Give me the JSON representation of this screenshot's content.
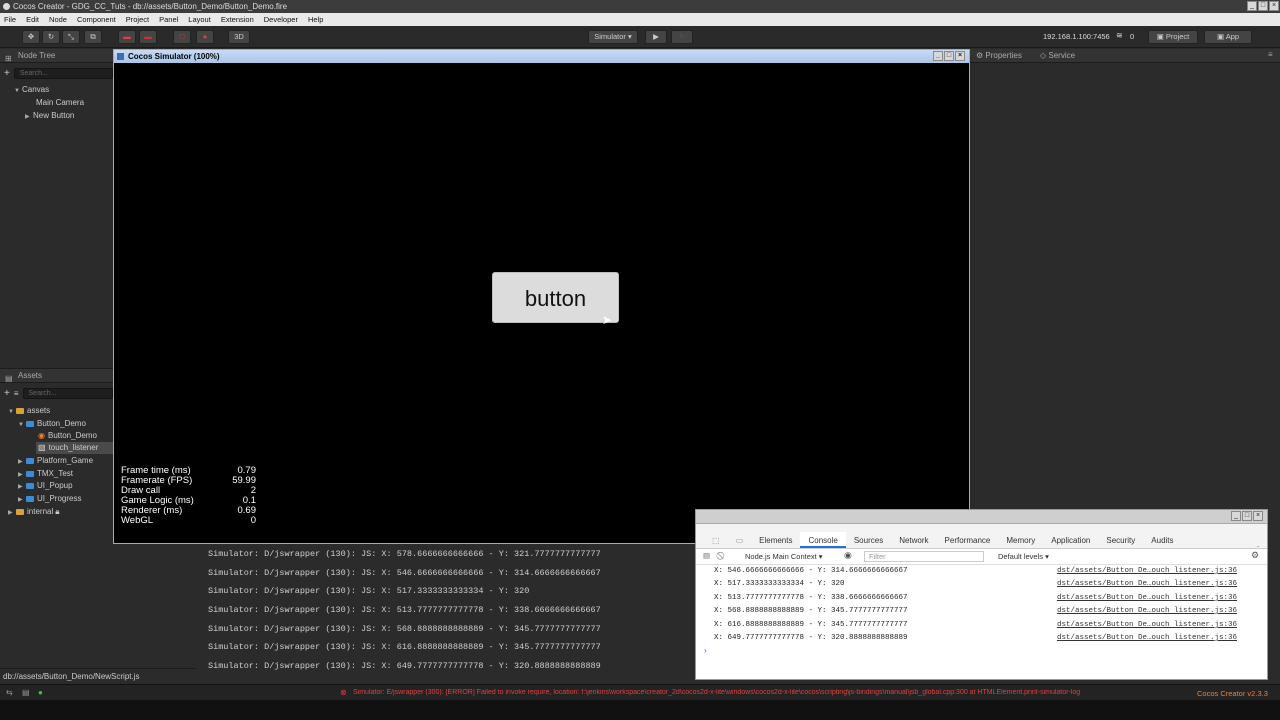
{
  "window": {
    "title": "Cocos Creator - GDG_CC_Tuts - db://assets/Button_Demo/Button_Demo.fire"
  },
  "menu": [
    "File",
    "Edit",
    "Node",
    "Component",
    "Project",
    "Panel",
    "Layout",
    "Extension",
    "Developer",
    "Help"
  ],
  "toolbar": {
    "mode_3d": "3D",
    "platform": "Simulator ▾",
    "ip": "192.168.1.100:7456",
    "connections": "0",
    "project_label": "Project",
    "app_label": "App"
  },
  "node_tree": {
    "title": "Node Tree",
    "search_placeholder": "Search...",
    "items": [
      "Canvas",
      "Main Camera",
      "New Button"
    ]
  },
  "assets": {
    "title": "Assets",
    "search_placeholder": "Search...",
    "items": [
      "assets",
      "Button_Demo",
      "Button_Demo",
      "touch_listener",
      "Platform_Game",
      "TMX_Test",
      "UI_Popup",
      "UI_Progress",
      "internal"
    ]
  },
  "right_tabs": {
    "properties": "Properties",
    "service": "Service"
  },
  "simulator": {
    "title": "Cocos Simulator (100%)",
    "button_label": "button",
    "stats": [
      {
        "label": "Frame time (ms)",
        "value": "0.79"
      },
      {
        "label": "Framerate (FPS)",
        "value": "59.99"
      },
      {
        "label": "Draw call",
        "value": "2"
      },
      {
        "label": "Game Logic (ms)",
        "value": "0.1"
      },
      {
        "label": "Renderer (ms)",
        "value": "0.69"
      },
      {
        "label": "WebGL",
        "value": "0"
      }
    ]
  },
  "log_lines": [
    "Simulator: D/jswrapper (130): JS: X: 578.6666666666666 - Y: 321.7777777777777",
    "Simulator: D/jswrapper (130): JS: X: 546.6666666666666 - Y: 314.6666666666667",
    "Simulator: D/jswrapper (130): JS: X: 517.3333333333334 - Y: 320",
    "Simulator: D/jswrapper (130): JS: X: 513.7777777777778 - Y: 338.6666666666667",
    "Simulator: D/jswrapper (130): JS: X: 568.8888888888889 - Y: 345.7777777777777",
    "Simulator: D/jswrapper (130): JS: X: 616.8888888888889 - Y: 345.7777777777777",
    "Simulator: D/jswrapper (130): JS: X: 649.7777777777778 - Y: 320.8888888888889"
  ],
  "devtools": {
    "tabs": [
      "Elements",
      "Console",
      "Sources",
      "Network",
      "Performance",
      "Memory",
      "Application",
      "Security",
      "Audits"
    ],
    "active_tab": "Console",
    "context": "Node.js Main Context ▾",
    "filter_placeholder": "Filter",
    "levels": "Default levels ▾",
    "lines": [
      {
        "text": "X: 546.6666666666666 - Y: 314.6666666666667",
        "src": "dst/assets/Button De…ouch listener.js:36"
      },
      {
        "text": "X: 517.3333333333334 - Y: 320",
        "src": "dst/assets/Button De…ouch listener.js:36"
      },
      {
        "text": "X: 513.7777777777778 - Y: 338.6666666666667",
        "src": "dst/assets/Button De…ouch listener.js:36"
      },
      {
        "text": "X: 568.8888888888889 - Y: 345.7777777777777",
        "src": "dst/assets/Button De…ouch listener.js:36"
      },
      {
        "text": "X: 616.8888888888889 - Y: 345.7777777777777",
        "src": "dst/assets/Button De…ouch listener.js:36"
      },
      {
        "text": "X: 649.7777777777778 - Y: 320.8888888888889",
        "src": "dst/assets/Button De…ouch listener.js:36"
      }
    ]
  },
  "status": {
    "path": "db://assets/Button_Demo/NewScript.js",
    "error": "Simulator: E/jswrapper (300): [ERROR] Failed to invoke require, location: f:\\jenkins\\workspace\\creator_2d\\cocos2d-x-lite\\windows\\cocos2d-x-lite\\cocos\\scripting\\js-bindings\\manual\\jsb_global.cpp:300 at HTMLElement.print-simulator-log",
    "version": "Cocos Creator v2.3.3"
  },
  "colors": {
    "accent_blue": "#1a73e8",
    "error_red": "#e04040",
    "version_orange": "#e8833a",
    "folder_blue": "#3a8cd8"
  }
}
